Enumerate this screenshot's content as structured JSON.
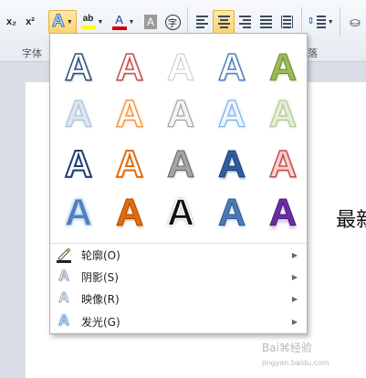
{
  "ribbon": {
    "font_group_label": "字体",
    "paragraph_group_label_partial": "落",
    "subscript_label": "x₂",
    "superscript_label": "x²",
    "text_effect_glyph": "A",
    "highlight_glyph": "ab",
    "font_color_glyph": "A",
    "char_shading_glyph": "A",
    "enclose_glyph": "字",
    "highlight_color": "#ffff00",
    "font_color": "#d00000"
  },
  "document": {
    "partial_text": "最新"
  },
  "text_effects_menu": {
    "gallery_letter": "A",
    "gallery_styles": [
      "fill-white-outline-dark-blue",
      "fill-white-outline-red",
      "fill-white-outline-grey",
      "fill-white-outline-light-blue",
      "fill-green-outline",
      "soft-blue-glow",
      "orange-glow",
      "grey-glow",
      "blue-glow",
      "green-glow",
      "white-outline-dark-blue",
      "white-outline-orange",
      "grey-gradient",
      "blue-gradient",
      "pink-outline-red",
      "blue-glow-solid",
      "orange-solid",
      "black-white-outline",
      "blue-shadow",
      "purple-reflection"
    ],
    "items": [
      {
        "label": "轮廓(O)",
        "icon": "outline-icon"
      },
      {
        "label": "阴影(S)",
        "icon": "shadow-icon"
      },
      {
        "label": "映像(R)",
        "icon": "reflection-icon"
      },
      {
        "label": "发光(G)",
        "icon": "glow-icon"
      }
    ]
  },
  "watermark": {
    "text": "Bai",
    "paw": "⌘",
    "suffix": "经验",
    "site": "jingyan.baidu.com"
  }
}
